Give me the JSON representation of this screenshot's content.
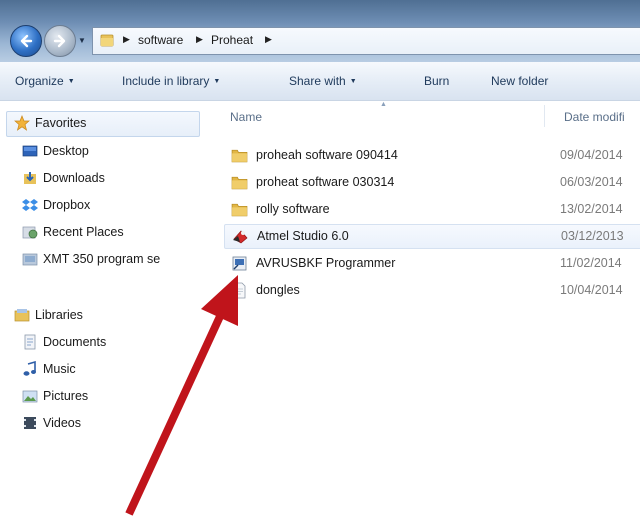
{
  "address": {
    "crumbs": [
      "software",
      "Proheat"
    ]
  },
  "commands": [
    {
      "label": "Organize",
      "dropdown": true
    },
    {
      "label": "Include in library",
      "dropdown": true
    },
    {
      "label": "Share with",
      "dropdown": true
    },
    {
      "label": "Burn",
      "dropdown": false
    },
    {
      "label": "New folder",
      "dropdown": false
    }
  ],
  "nav": {
    "favorites": {
      "label": "Favorites",
      "items": [
        "Desktop",
        "Downloads",
        "Dropbox",
        "Recent Places",
        "XMT 350 program se"
      ]
    },
    "libraries": {
      "label": "Libraries",
      "items": [
        "Documents",
        "Music",
        "Pictures",
        "Videos"
      ]
    }
  },
  "columns": {
    "name": "Name",
    "date": "Date modifi"
  },
  "files": [
    {
      "name": "proheah software 090414",
      "date": "09/04/2014",
      "icon": "folder-icon"
    },
    {
      "name": "proheat software 030314",
      "date": "06/03/2014",
      "icon": "folder-icon"
    },
    {
      "name": "rolly software",
      "date": "13/02/2014",
      "icon": "folder-icon"
    },
    {
      "name": "Atmel Studio 6.0",
      "date": "03/12/2013",
      "icon": "atmel-studio-icon",
      "selected": true
    },
    {
      "name": "AVRUSBKF Programmer",
      "date": "11/02/2014",
      "icon": "programmer-shortcut-icon"
    },
    {
      "name": "dongles",
      "date": "10/04/2014",
      "icon": "text-file-icon"
    }
  ],
  "annotation": {
    "color": "#c0141b",
    "icon": "red-arrow-pointer"
  }
}
